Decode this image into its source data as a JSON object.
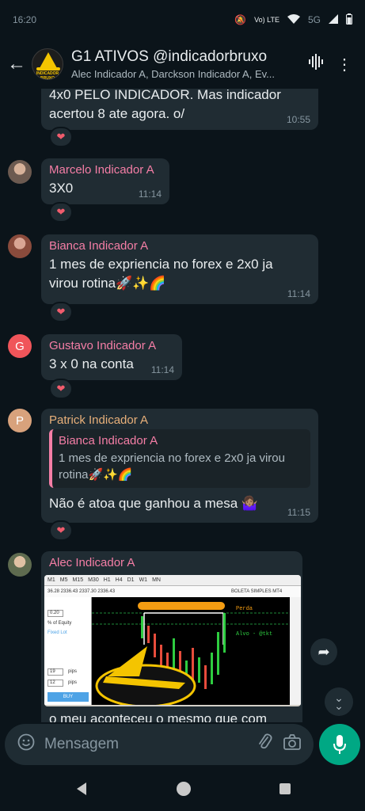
{
  "status": {
    "time": "16:20",
    "network": "Vo) LTE",
    "signal": "5G"
  },
  "header": {
    "title": "G1 ATIVOS @indicadorbruxo",
    "subtitle": "Alec Indicador A, Darckson Indicador A, Ev...",
    "avatar_text": "INDICADOR BRUXO"
  },
  "messages": [
    {
      "text": "4x0 PELO INDICADOR. Mas indicador acertou 8 ate agora. o/",
      "time": "10:55",
      "reaction": "❤"
    },
    {
      "sender": "Marcelo Indicador A",
      "sender_color": "#f57ea6",
      "text": "3X0",
      "time": "11:14",
      "reaction": "❤"
    },
    {
      "sender": "Bianca Indicador A",
      "sender_color": "#f57ea6",
      "text": "1 mes de expriencia no forex e 2x0 ja virou rotina🚀✨🌈",
      "time": "11:14",
      "reaction": "❤"
    },
    {
      "sender": "Gustavo Indicador A",
      "sender_color": "#f57ea6",
      "avatar_letter": "G",
      "avatar_color": "#f0555a",
      "text": "3 x 0 na conta",
      "time": "11:14",
      "reaction": "❤"
    },
    {
      "sender": "Patrick Indicador A",
      "sender_color": "#e8b07a",
      "avatar_letter": "P",
      "avatar_color": "#d8a27c",
      "quote_sender": "Bianca Indicador A",
      "quote_text": "1 mes de expriencia no forex e 2x0 ja virou rotina🚀✨🌈",
      "text": "Não é atoa que ganhou a mesa 🤷🏽‍♀️",
      "time": "11:15",
      "reaction": "❤"
    },
    {
      "sender": "Alec Indicador A",
      "sender_color": "#f57ea6",
      "text": "o meu aconteceu o mesmo que com"
    }
  ],
  "screenshot": {
    "toolbar": [
      "M1",
      "M5",
      "M15",
      "M30",
      "H1",
      "H4",
      "D1",
      "W1",
      "MN"
    ],
    "price_line": "36.28 2336.43 2337.30 2336.43",
    "boleta": "BOLETA SIMPLES MT4",
    "lot": "0.20",
    "lot_label": "% of Equity",
    "fixed_lot": "Fixed Lot",
    "pips1": "19",
    "pips2": "12",
    "pips_label": "pips",
    "buy": "BUY",
    "alvo": "Alvo - @tkt",
    "perda": "Perda"
  },
  "composer": {
    "placeholder": "Mensagem"
  }
}
